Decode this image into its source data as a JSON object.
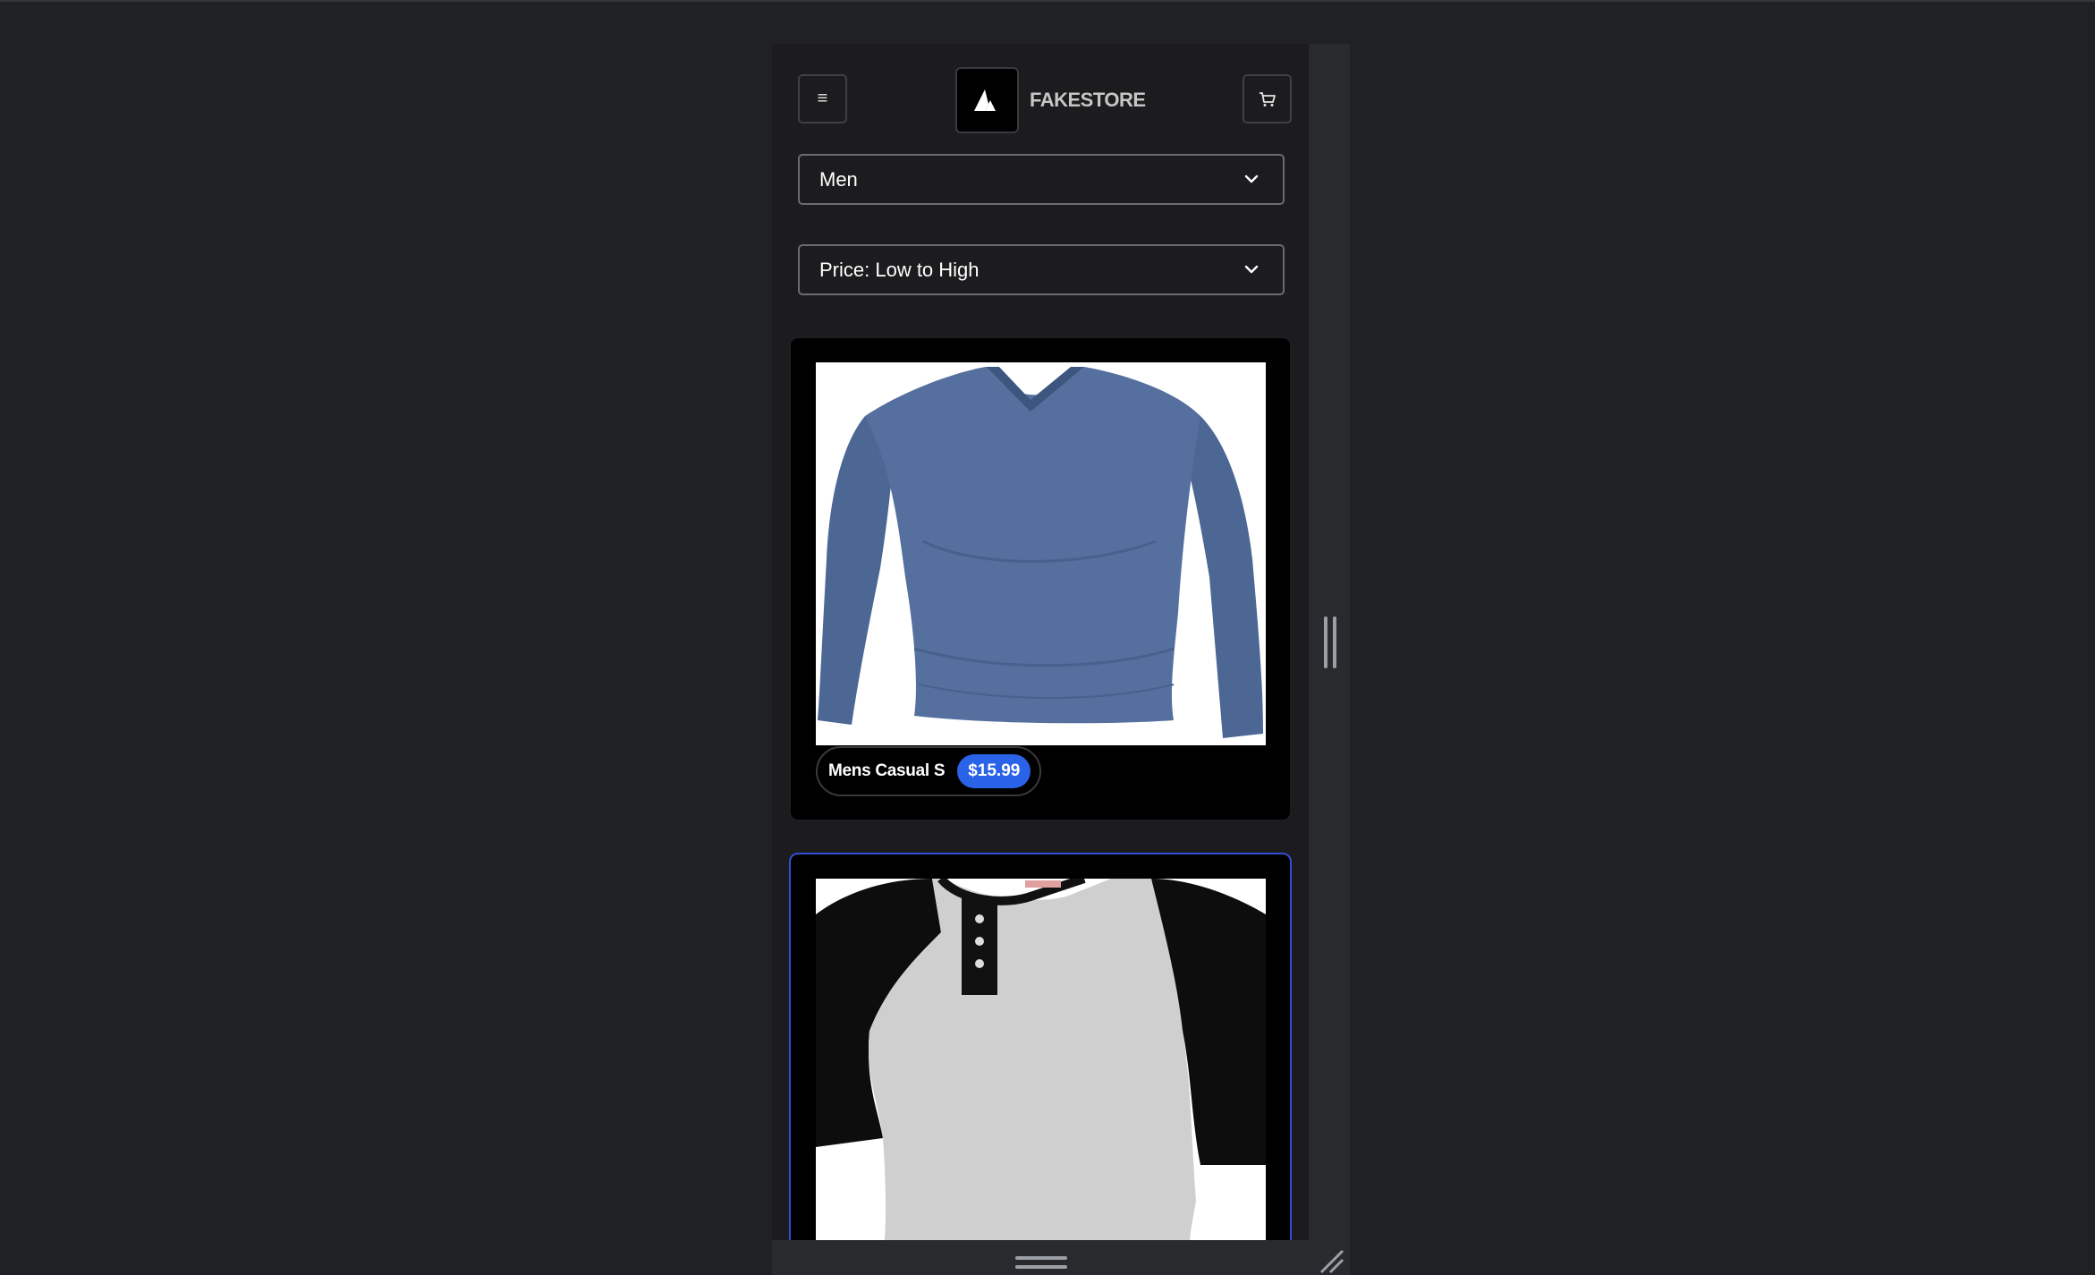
{
  "header": {
    "brand_name": "FAKESTORE",
    "menu_icon": "hamburger-icon",
    "cart_icon": "cart-icon",
    "logo_icon": "triangle-logo-icon"
  },
  "filters": {
    "category_selected": "Men",
    "sort_selected": "Price: Low to High"
  },
  "products": [
    {
      "name": "Mens Casual S",
      "price": "$15.99",
      "image": "blue long-sleeve v-neck shirt"
    },
    {
      "name": "",
      "price": "",
      "image": "grey and black raglan henley shirt"
    }
  ],
  "colors": {
    "accent": "#2a62e8",
    "background": "#1c1c1e",
    "card": "#000000",
    "selected_border": "#2f4fd6"
  }
}
